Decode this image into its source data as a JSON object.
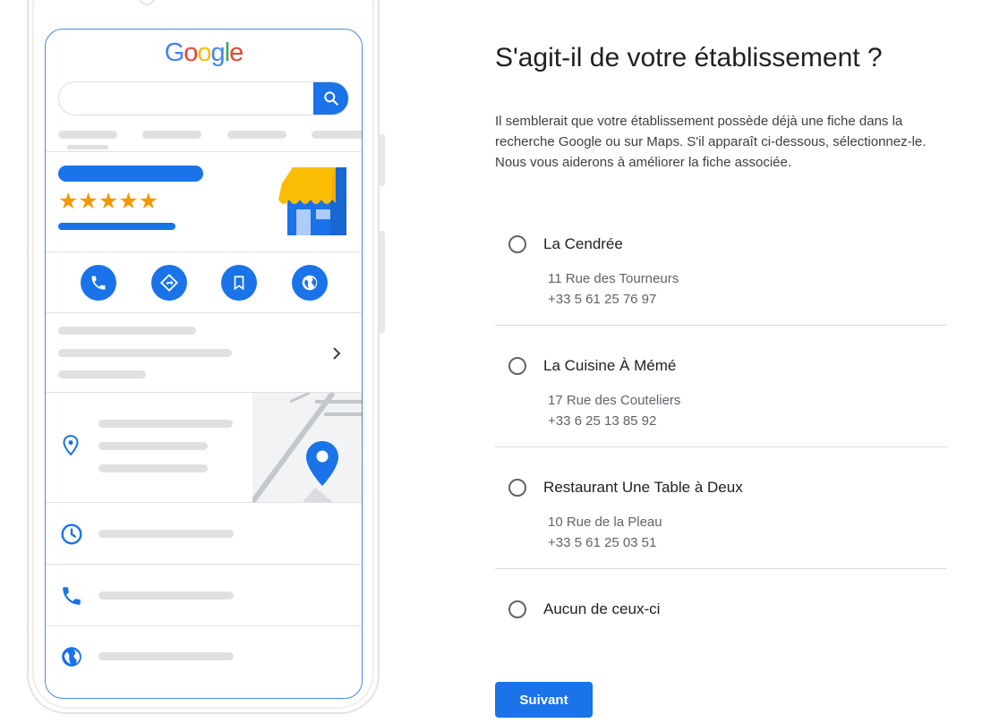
{
  "illustration": {
    "logo_letters": [
      {
        "char": "G",
        "color": "#4285F4"
      },
      {
        "char": "o",
        "color": "#EA4335"
      },
      {
        "char": "o",
        "color": "#FBBC05"
      },
      {
        "char": "g",
        "color": "#4285F4"
      },
      {
        "char": "l",
        "color": "#34A853"
      },
      {
        "char": "e",
        "color": "#EA4335"
      }
    ],
    "stars": "★★★★★",
    "icons": {
      "search": "search-icon",
      "store": "storefront-icon",
      "actions": [
        "phone-icon",
        "directions-icon",
        "bookmark-icon",
        "web-globe-icon"
      ],
      "chevron": "chevron-right-icon",
      "location": "location-pin-icon",
      "map_marker": "map-marker-icon",
      "clock": "clock-icon",
      "phone": "phone-icon",
      "globe": "globe-icon"
    }
  },
  "page": {
    "title": "S'agit-il de votre établissement ?",
    "description": "Il semblerait que votre établissement possède déjà une fiche dans la recherche Google ou sur Maps. S'il apparaît ci-dessous, sélectionnez-le. Nous vous aiderons à améliorer la fiche associée."
  },
  "options": [
    {
      "name": "La Cendrée",
      "address": "11 Rue des Tourneurs",
      "phone": "+33 5 61 25 76 97",
      "selected": false
    },
    {
      "name": "La Cuisine À Mémé",
      "address": "17 Rue des Couteliers",
      "phone": "+33 6 25 13 85 92",
      "selected": false
    },
    {
      "name": "Restaurant Une Table à Deux",
      "address": "10 Rue de la Pleau",
      "phone": "+33 5 61 25 03 51",
      "selected": false
    },
    {
      "name": "Aucun de ceux-ci",
      "selected": false
    }
  ],
  "actions": {
    "next_label": "Suivant"
  },
  "colors": {
    "accent": "#1a73e8",
    "star": "#f29900",
    "awning": "#fbbc04",
    "text_primary": "#202124",
    "text_secondary": "#5f6368"
  }
}
